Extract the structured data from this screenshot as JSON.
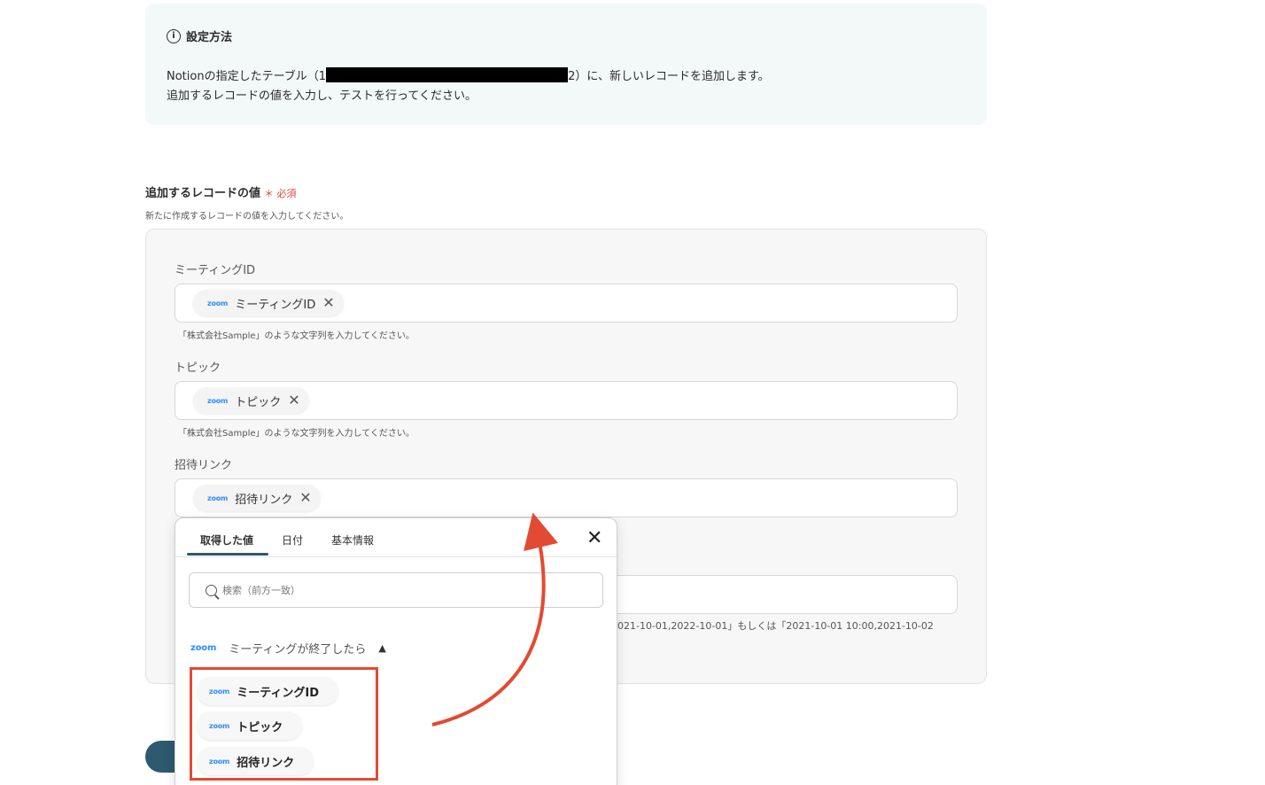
{
  "info": {
    "title": "設定方法",
    "line1_prefix": "Notionの指定したテーブル（1",
    "line1_suffix": "2）に、新しいレコードを追加します。",
    "line2": "追加するレコードの値を入力し、テストを行ってください。"
  },
  "section": {
    "label": "追加するレコードの値",
    "required": "＊ 必須",
    "help": "新たに作成するレコードの値を入力してください。"
  },
  "fields": [
    {
      "label": "ミーティングID",
      "chip": "ミーティングID",
      "hint": "「株式会社Sample」のような文字列を入力してください。"
    },
    {
      "label": "トピック",
      "chip": "トピック",
      "hint": "「株式会社Sample」のような文字列を入力してください。"
    },
    {
      "label": "招待リンク",
      "chip": "招待リンク"
    }
  ],
  "partial_hint": "021-10-01,2022-10-01」もしくは「2021-10-01 10:00,2021-10-02",
  "zoom_logo": "zoom",
  "popup": {
    "tabs": [
      "取得した値",
      "日付",
      "基本情報"
    ],
    "search_placeholder": "検索（前方一致）",
    "group_title": "ミーティングが終了したら",
    "items": [
      "ミーティングID",
      "トピック",
      "招待リンク"
    ]
  },
  "colors": {
    "accent": "#2d5a6e",
    "highlight": "#e24a33",
    "required": "#e0483a",
    "zoom": "#2d8cff"
  }
}
